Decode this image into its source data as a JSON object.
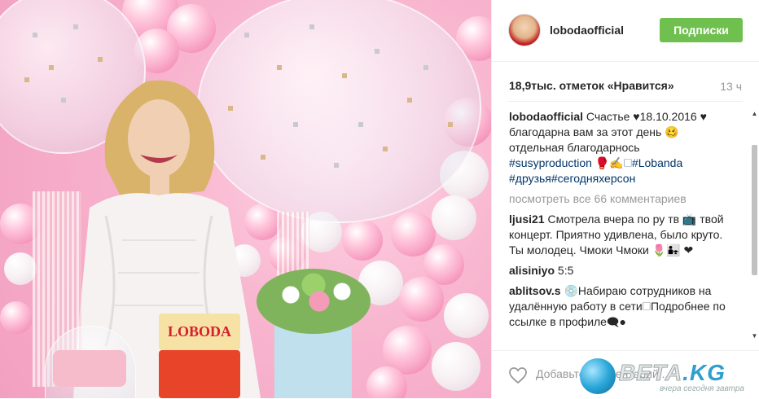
{
  "post": {
    "username": "lobodaofficial",
    "follow_label": "Подписки",
    "likes": "18,9тыс. отметок «Нравится»",
    "time": "13 ч",
    "caption": {
      "user": "lobodaofficial",
      "text": "Счастье ♥18.10.2016 ♥ благодарна вам за этот день 🥴 отдельная благодарнось",
      "tags_line1": "#susyproduction",
      "emoji_tail": "🥊✍️🗆#Lobanda",
      "tags_line2": "#друзья#сегодняхерсон"
    },
    "view_all": "посмотреть все 66 комментариев",
    "comments": [
      {
        "user": "ljusi21",
        "text": "Смотрела вчера по ру тв 📺 твой концерт. Приятно удивлена, было круто. Ты молодец. Чмоки Чмоки 🌷👨‍👧 ❤"
      },
      {
        "user": "alisiniyo",
        "text": "5:5"
      },
      {
        "user": "ablitsov.s",
        "text": "💿Набираю сотрудников на удалённую работу в сети🗆Подробнее по ссылке в профиле🗨●"
      }
    ],
    "add_comment_placeholder": "Добавьте комментарий..."
  },
  "photo": {
    "cake_label": "LOBODA"
  },
  "watermark": {
    "brand": "BETA",
    "brand_suffix": ".KG",
    "tagline": "вчера сегодня завтра"
  },
  "colors": {
    "follow_bg": "#70c050",
    "hashtag": "#003569"
  },
  "icons": {
    "like": "heart-outline-icon",
    "scroll_up": "scroll-up-arrow-icon",
    "scroll_down": "scroll-down-arrow-icon"
  }
}
